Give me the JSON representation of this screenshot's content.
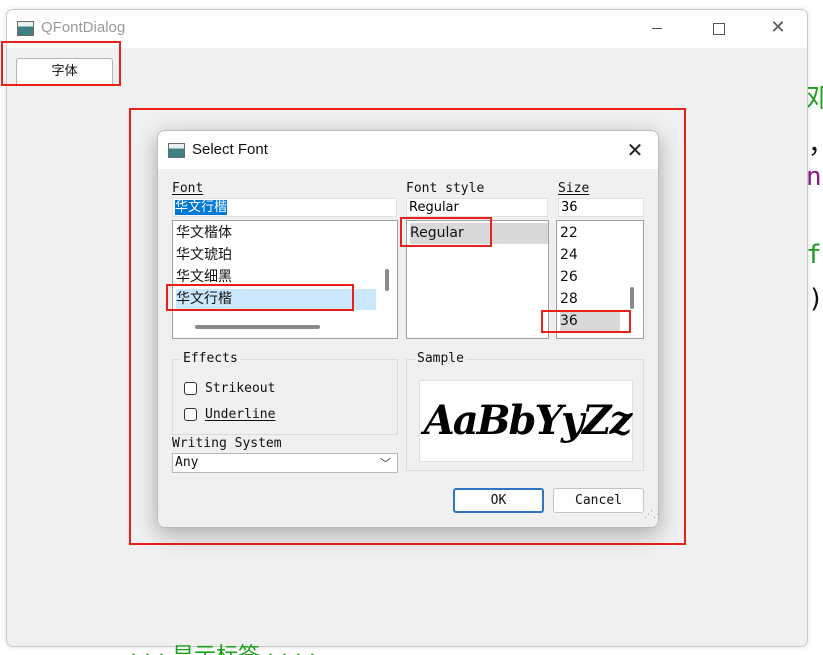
{
  "main_window": {
    "title": "QFontDialog",
    "font_button_label": "字体"
  },
  "background_code": {
    "frag1": "邓",
    "frag2": "，",
    "frag3": "nt",
    "frag4": "f",
    "frag5": ")",
    "bottom_fragment": "·       ·       ·   显示标签   ·       ·       ·       ·"
  },
  "dialog": {
    "title": "Select Font",
    "font_label": "Font",
    "font_value": "华文行楷",
    "font_items": [
      "华文楷体",
      "华文琥珀",
      "华文细黑",
      "华文行楷"
    ],
    "style_label": "Font style",
    "style_value": "Regular",
    "style_items": [
      "Regular"
    ],
    "size_label": "Size",
    "size_value": "36",
    "size_items": [
      "22",
      "24",
      "26",
      "28",
      "36"
    ],
    "effects_label": "Effects",
    "strikeout_label": "Strikeout",
    "underline_label": "Underline",
    "writing_system_label": "Writing System",
    "writing_system_value": "Any",
    "sample_label": "Sample",
    "sample_text": "AaBbYyZz",
    "ok_label": "OK",
    "cancel_label": "Cancel"
  },
  "colors": {
    "annotation_red": "#e8201a",
    "selection_blue": "#cce8ff",
    "default_button_border": "#2f74c7",
    "code_green": "#1aa01a",
    "code_purple": "#8b1e8b"
  }
}
